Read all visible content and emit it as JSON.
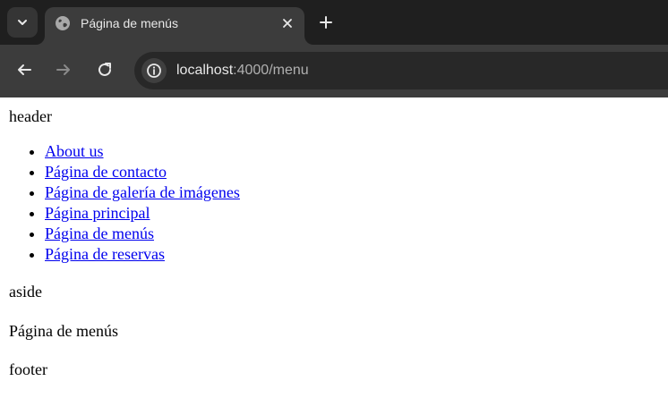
{
  "browser": {
    "tab": {
      "title": "Página de menús",
      "favicon": "globe-icon"
    },
    "toolbar": {
      "back_icon": "arrow-left-icon",
      "forward_icon": "arrow-right-icon",
      "reload_icon": "reload-icon",
      "site_info_icon": "site-info-icon"
    },
    "url": {
      "host": "localhost",
      "path": ":4000/menu"
    }
  },
  "page": {
    "header": "header",
    "nav": [
      {
        "label": "About us"
      },
      {
        "label": "Página de contacto"
      },
      {
        "label": "Página de galería de imágenes"
      },
      {
        "label": "Página principal"
      },
      {
        "label": "Página de menús"
      },
      {
        "label": "Página de reservas"
      }
    ],
    "aside": "aside",
    "main": "Página de menús",
    "footer": "footer"
  },
  "colors": {
    "tabstrip_bg": "#1f1f1f",
    "toolbar_bg": "#3c3c3c",
    "omnibox_bg": "#282828",
    "link": "#0000ee",
    "page_bg": "#ffffff"
  }
}
